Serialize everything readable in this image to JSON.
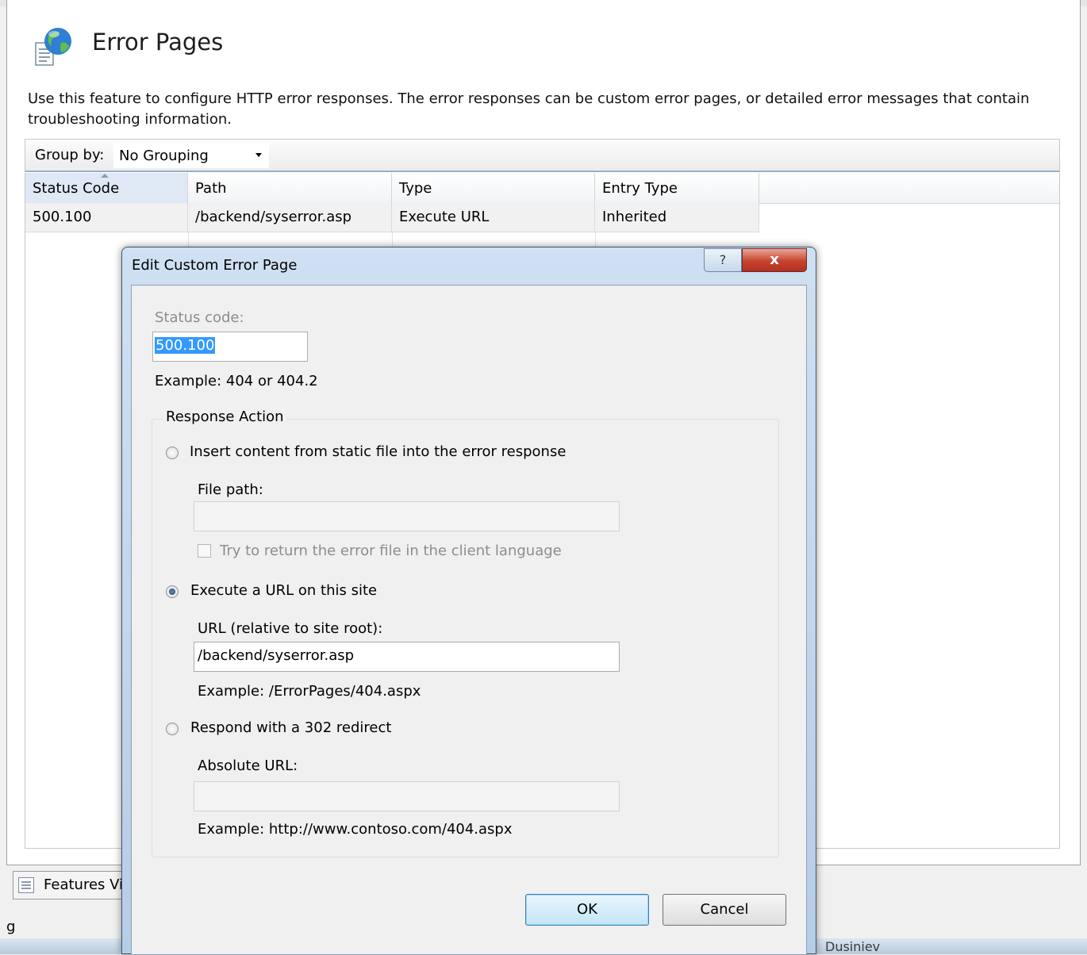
{
  "page": {
    "title": "Error Pages",
    "description": "Use this feature to configure HTTP error responses. The error responses can be custom error pages, or detailed error messages that contain troubleshooting information."
  },
  "toolbar": {
    "group_by_label": "Group by:",
    "group_by_value": "No Grouping"
  },
  "grid": {
    "columns": [
      "Status Code",
      "Path",
      "Type",
      "Entry Type"
    ],
    "rows": [
      [
        "500.100",
        "/backend/syserror.asp",
        "Execute URL",
        "Inherited"
      ]
    ]
  },
  "bottom": {
    "tab_label": "Features Vi",
    "status_char": "g",
    "behind_text": "Dusiniev"
  },
  "dialog": {
    "title": "Edit Custom Error Page",
    "help_glyph": "?",
    "close_glyph": "x",
    "status_code_label": "Status code:",
    "status_code_value": "500.100",
    "status_example": "Example: 404 or 404.2",
    "group_title": "Response Action",
    "option_static": "Insert content from static file into the error response",
    "file_path_label": "File path:",
    "file_path_value": "",
    "client_language_label": "Try to return the error file in the client language",
    "option_execute": "Execute a URL on this site",
    "url_label": "URL (relative to site root):",
    "url_value": "/backend/syserror.asp",
    "url_example": "Example: /ErrorPages/404.aspx",
    "option_redirect": "Respond with a 302 redirect",
    "absolute_url_label": "Absolute URL:",
    "absolute_url_value": "",
    "absolute_url_example": "Example: http://www.contoso.com/404.aspx",
    "ok_label": "OK",
    "cancel_label": "Cancel"
  }
}
